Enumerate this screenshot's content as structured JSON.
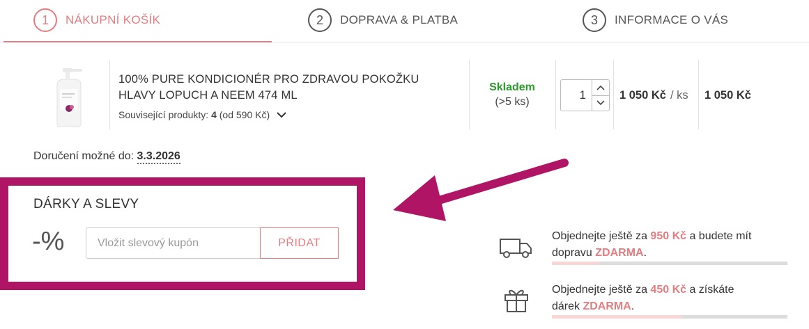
{
  "steps": [
    {
      "number": "1",
      "label": "NÁKUPNÍ KOŠÍK",
      "active": true
    },
    {
      "number": "2",
      "label": "DOPRAVA & PLATBA",
      "active": false
    },
    {
      "number": "3",
      "label": "INFORMACE O VÁS",
      "active": false
    }
  ],
  "product": {
    "name": "100% PURE KONDICIONÉR PRO ZDRAVOU POKOŽKU HLAVY LOPUCH A NEEM 474 ML",
    "related_label": "Související produkty:",
    "related_count": "4",
    "related_price": "(od 590 Kč)",
    "stock_status": "Skladem",
    "stock_qty": "(>5 ks)",
    "quantity": "1",
    "unit_price": "1 050 Kč",
    "unit_suffix": "/ ks",
    "total_price": "1 050 Kč"
  },
  "delivery": {
    "label": "Doručení možné do:",
    "date": "3.3.2026"
  },
  "discounts": {
    "title": "DÁRKY A SLEVY",
    "percent_symbol": "-%",
    "coupon_placeholder": "Vložit slevový kupón",
    "add_label": "PŘIDAT"
  },
  "promos": {
    "shipping": {
      "line1_pre": "Objednejte ještě za ",
      "amount": "950 Kč",
      "line1_post": " a budete mít",
      "line2_pre": "dopravu ",
      "free": "ZDARMA",
      "line2_post": ".",
      "progress": 0.2
    },
    "gift": {
      "line1_pre": "Objednejte ještě za ",
      "amount": "450 Kč",
      "line1_post": " a získáte",
      "line2_pre": "dárek ",
      "free": "ZDARMA",
      "line2_post": ".",
      "progress": 0.55
    }
  },
  "colors": {
    "accent": "#e57d80",
    "highlight_frame": "#b01565",
    "stock_green": "#2a9a2a"
  }
}
